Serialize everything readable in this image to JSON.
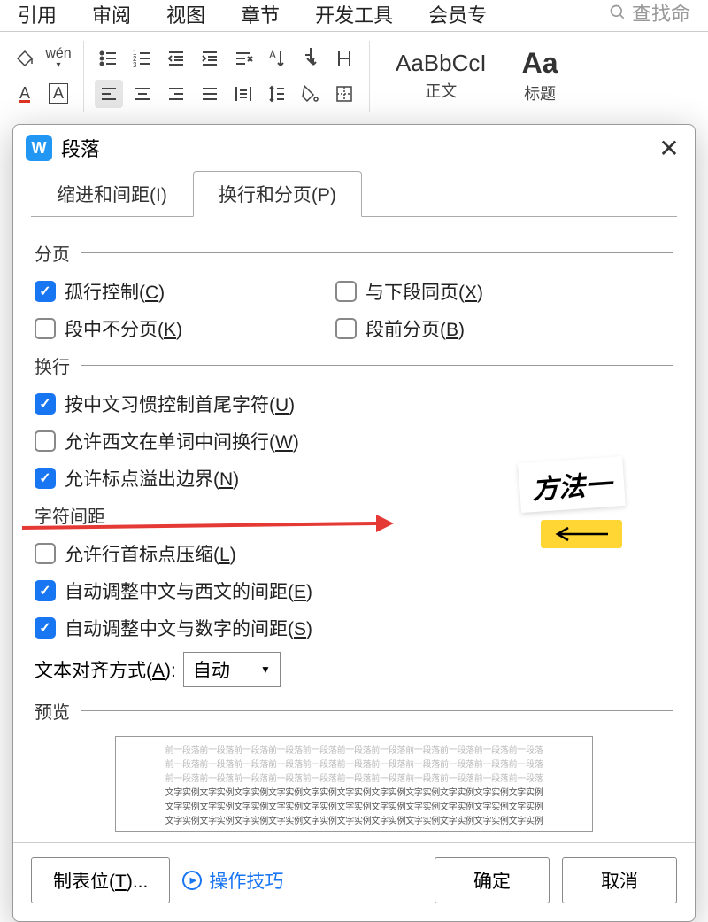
{
  "ribbon": {
    "tabs": [
      "引用",
      "审阅",
      "视图",
      "章节",
      "开发工具",
      "会员专"
    ],
    "search_placeholder": "查找命"
  },
  "styles": {
    "normal_sample": "AaBbCcI",
    "normal_label": "正文",
    "heading_sample": "Aa",
    "heading_label": "标题"
  },
  "modal": {
    "title": "段落",
    "tabs": {
      "indent": "缩进和间距(I)",
      "linebreak": "换行和分页(P)"
    },
    "sections": {
      "pagination": "分页",
      "linebreak": "换行",
      "charspacing": "字符间距",
      "preview": "预览"
    },
    "checkboxes": {
      "widow_control": "孤行控制(C)",
      "keep_with_next": "与下段同页(X)",
      "keep_lines_together": "段中不分页(K)",
      "page_break_before": "段前分页(B)",
      "cjk_first_last": "按中文习惯控制首尾字符(U)",
      "allow_latin_wrap": "允许西文在单词中间换行(W)",
      "allow_punct_overflow": "允许标点溢出边界(N)",
      "compress_punct": "允许行首标点压缩(L)",
      "auto_cjk_latin": "自动调整中文与西文的间距(E)",
      "auto_cjk_number": "自动调整中文与数字的间距(S)"
    },
    "alignment": {
      "label": "文本对齐方式(A):",
      "value": "自动"
    },
    "preview_light": "前一段落前一段落前一段落前一段落前一段落前一段落前一段落前一段落前一段落前一段落前一段落",
    "preview_dark": "文字实例文字实例文字实例文字实例文字实例文字实例文字实例文字实例文字实例文字实例文字实例",
    "footer": {
      "tabs_btn": "制表位(T)...",
      "tip": "操作技巧",
      "ok": "确定",
      "cancel": "取消"
    }
  },
  "annotation": {
    "label": "方法一"
  }
}
